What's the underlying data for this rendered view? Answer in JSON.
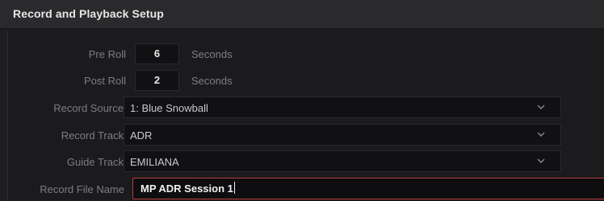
{
  "panel": {
    "title": "Record and Playback Setup"
  },
  "pre_roll": {
    "label": "Pre Roll",
    "value": "6",
    "unit": "Seconds"
  },
  "post_roll": {
    "label": "Post Roll",
    "value": "2",
    "unit": "Seconds"
  },
  "record_source": {
    "label": "Record Source",
    "value": "1: Blue Snowball",
    "icon": "chevron-down-icon"
  },
  "record_track": {
    "label": "Record Track",
    "value": "ADR",
    "icon": "chevron-down-icon"
  },
  "guide_track": {
    "label": "Guide Track",
    "value": "EMILIANA",
    "icon": "chevron-down-icon"
  },
  "record_file_name": {
    "label": "Record File Name",
    "value": "MP ADR Session 1"
  },
  "colors": {
    "focus_border": "#b53c3c",
    "label_text": "#7e7e83",
    "header_bg": "#2a2a2d"
  }
}
